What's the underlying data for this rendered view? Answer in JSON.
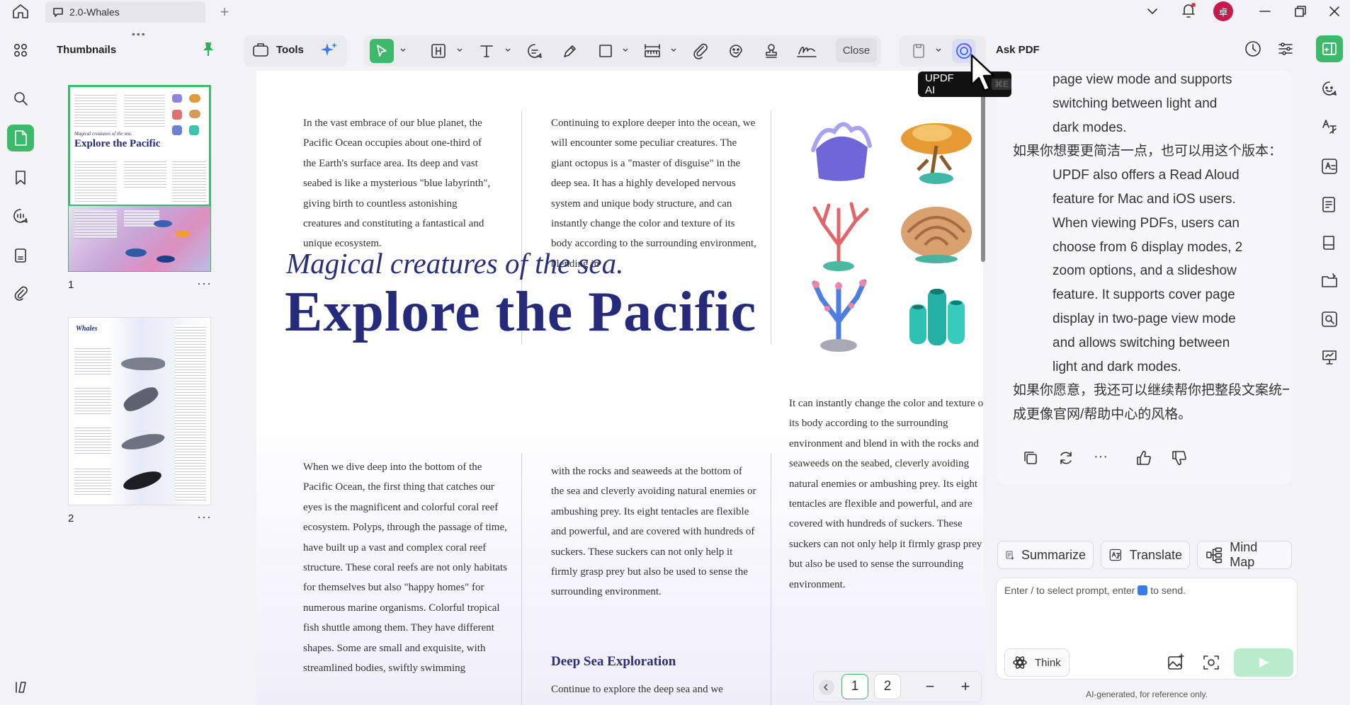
{
  "titlebar": {
    "tab_title": "2.0-Whales",
    "avatar_letter": "卓"
  },
  "thumbnails": {
    "title": "Thumbnails",
    "pages": [
      {
        "number": "1",
        "mini_subtitle": "Magical creatures of the sea.",
        "mini_title": "Explore the Pacific",
        "selected": true
      },
      {
        "number": "2",
        "mini_title": "Whales",
        "selected": false
      }
    ]
  },
  "toolbar": {
    "tools_label": "Tools",
    "close_label": "Close"
  },
  "tooltip": {
    "label": "UPDF AI",
    "shortcut": "⌘E"
  },
  "document": {
    "col1_top": "In the vast embrace of our blue planet, the Pacific Ocean occupies about one-third of the Earth's surface area. Its deep and vast seabed is like a mysterious \"blue labyrinth\", giving birth to countless astonishing creatures and constituting a fantastical and unique ecosystem.",
    "col2_top": "Continuing to explore deeper into the ocean, we will encounter some peculiar creatures. The giant octopus is a \"master of disguise\" in the deep sea. It has a highly developed nervous system and unique body structure, and can instantly change the color and texture of its body according to the surrounding environment, blending in",
    "subtitle": "Magical creatures of the sea.",
    "title": "Explore the Pacific",
    "col3_mid": "It can instantly change the color and texture of its body according to the surrounding environment and blend in with the rocks and seaweeds on the seabed, cleverly avoiding natural enemies or ambushing prey. Its eight tentacles are flexible and powerful, and are covered with hundreds of suckers. These suckers can not only help it firmly grasp prey but also be used to sense the surrounding environment.",
    "col1_bottom": "When we dive deep into the bottom of the Pacific Ocean, the first thing that catches our eyes is the magnificent and colorful coral reef ecosystem. Polyps, through the passage of time, have built up a vast and complex coral reef structure. These coral reefs are not only habitats for themselves but also \"happy homes\" for numerous marine organisms. Colorful tropical fish shuttle among them. They have different shapes. Some are small and exquisite, with streamlined bodies, swiftly swimming",
    "col2_bottom": "with the rocks and seaweeds at the bottom of the sea and cleverly avoiding natural enemies or ambushing prey. Its eight tentacles are flexible and powerful, and are covered with hundreds of suckers. These suckers can not only help it firmly grasp prey but also be used to sense the surrounding environment.",
    "section_heading": "Deep Sea Exploration",
    "section_text": "Continue to explore the deep sea and we"
  },
  "pager": {
    "page1": "1",
    "page2": "2",
    "zoom_out": "−",
    "zoom_in": "+"
  },
  "ask_pdf": {
    "title": "Ask PDF",
    "lines": [
      {
        "indent": true,
        "text": "page view mode and supports"
      },
      {
        "indent": true,
        "text": "switching between light and"
      },
      {
        "indent": true,
        "text": "dark modes."
      },
      {
        "indent": false,
        "text": "如果你想要更简洁一点，也可以用这个版本："
      },
      {
        "indent": true,
        "text": "UPDF also offers a Read Aloud"
      },
      {
        "indent": true,
        "text": "feature for Mac and iOS users."
      },
      {
        "indent": true,
        "text": "When viewing PDFs, users can"
      },
      {
        "indent": true,
        "text": "choose from 6 display modes, 2"
      },
      {
        "indent": true,
        "text": "zoom options, and a slideshow"
      },
      {
        "indent": true,
        "text": "feature. It supports cover page"
      },
      {
        "indent": true,
        "text": "display in two-page view mode"
      },
      {
        "indent": true,
        "text": "and allows switching between"
      },
      {
        "indent": true,
        "text": "light and dark modes."
      },
      {
        "indent": false,
        "text": "如果你愿意，我还可以继续帮你把整段文案统一"
      },
      {
        "indent": false,
        "text": "成更像官网/帮助中心的风格。"
      }
    ],
    "summarize": "Summarize",
    "translate": "Translate",
    "mindmap": "Mind Map",
    "placeholder_a": "Enter / to select prompt, enter",
    "placeholder_b": "to send.",
    "think": "Think",
    "disclaimer": "AI-generated, for reference only."
  }
}
